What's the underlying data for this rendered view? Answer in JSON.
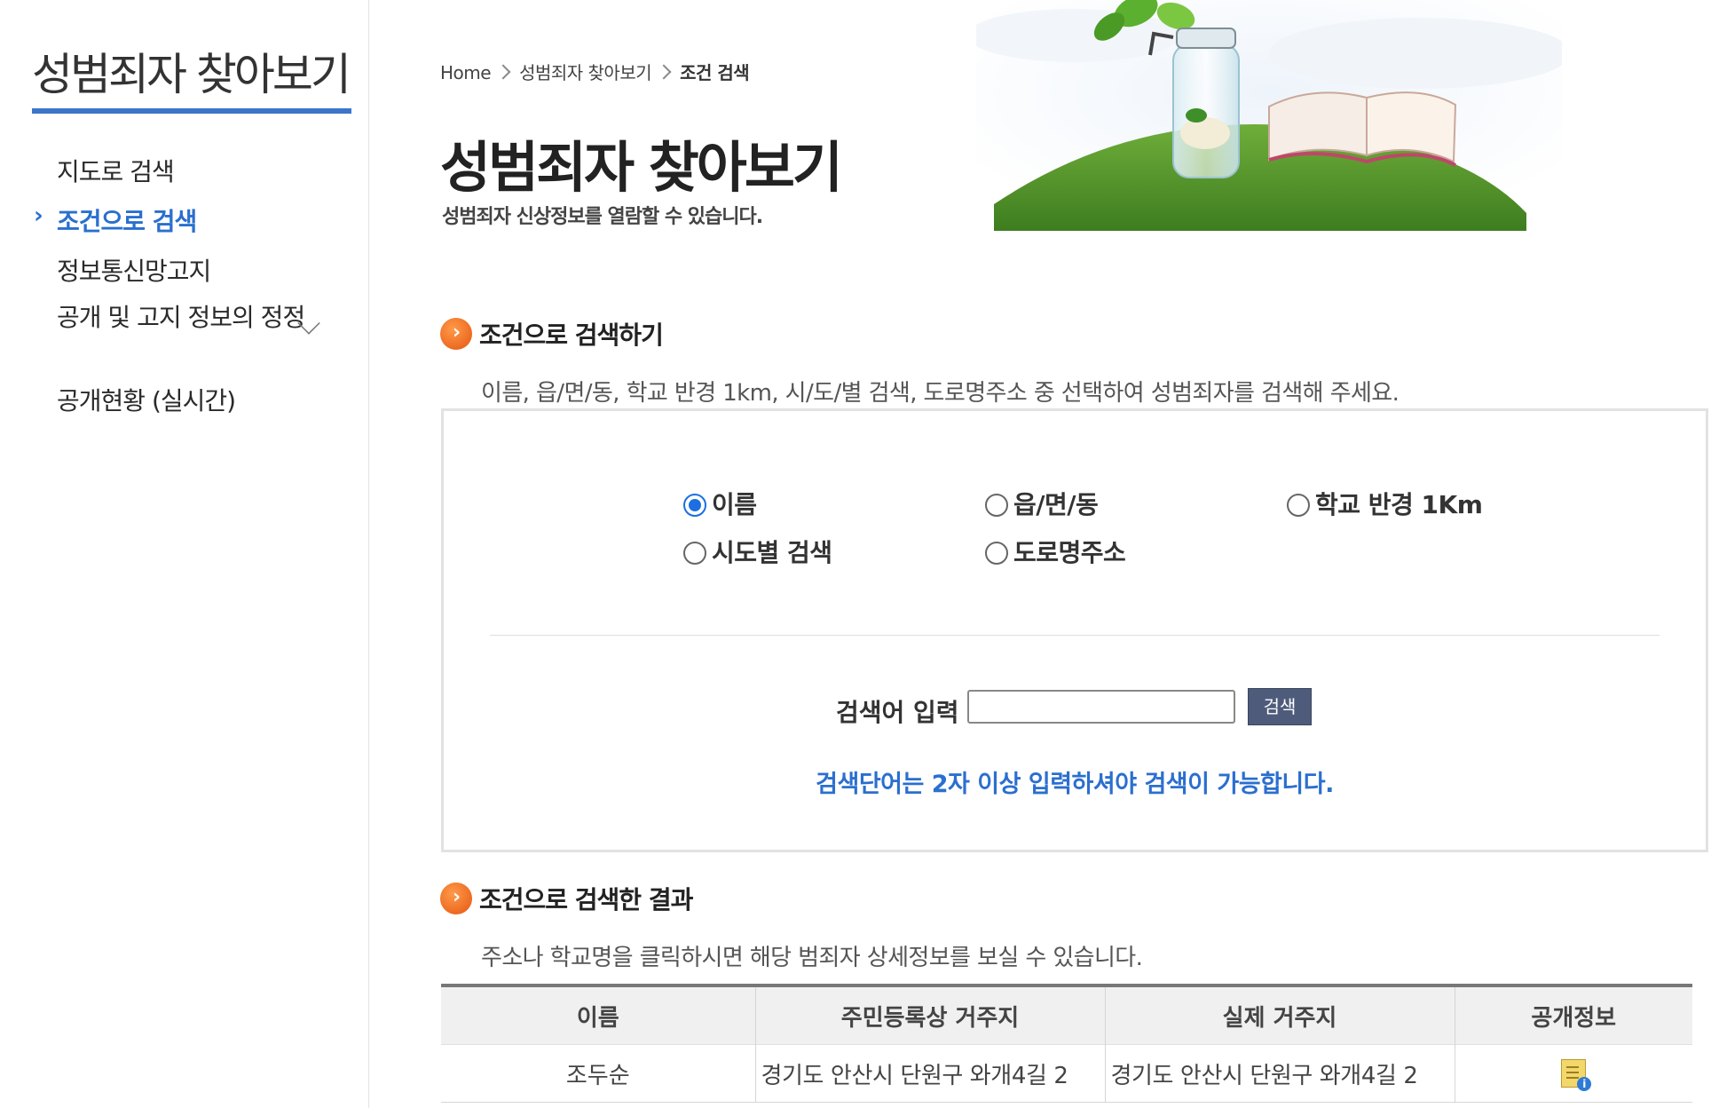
{
  "sidebar": {
    "title": "성범죄자 찾아보기",
    "items": [
      {
        "label": "지도로 검색"
      },
      {
        "label": "조건으로 검색"
      },
      {
        "label": "정보통신망고지"
      },
      {
        "label": "공개 및 고지 정보의 정정"
      },
      {
        "label": "공개현황 (실시간)"
      }
    ]
  },
  "breadcrumb": [
    "Home",
    "성범죄자 찾아보기",
    "조건 검색"
  ],
  "header": {
    "title": "성범죄자 찾아보기",
    "subtitle": "성범죄자 신상정보를 열람할 수 있습니다."
  },
  "search_section": {
    "heading": "조건으로 검색하기",
    "description": "이름, 읍/면/동, 학교 반경 1km, 시/도/별 검색, 도로명주소 중 선택하여 성범죄자를 검색해 주세요.",
    "options": [
      "이름",
      "읍/면/동",
      "학교 반경 1Km",
      "시도별 검색",
      "도로명주소"
    ],
    "selected": "이름",
    "input_label": "검색어 입력",
    "input_value": "",
    "button_label": "검색",
    "hint": "검색단어는 2자 이상 입력하셔야 검색이 가능합니다."
  },
  "results_section": {
    "heading": "조건으로 검색한 결과",
    "description": "주소나 학교명을 클릭하시면 해당 범죄자 상세정보를 보실 수 있습니다.",
    "columns": [
      "이름",
      "주민등록상 거주지",
      "실제 거주지",
      "공개정보"
    ],
    "rows": [
      {
        "name": "조두순",
        "registered_address": "경기도 안산시 단원구 와개4길 2",
        "actual_address": "경기도 안산시 단원구 와개4길 2",
        "info_icon": "document-info-icon"
      }
    ]
  },
  "colors": {
    "accent_blue": "#2b6fcf",
    "sidebar_rule": "#3d75c8",
    "bullet_orange": "#e4560f",
    "search_button": "#4f5b7b"
  }
}
